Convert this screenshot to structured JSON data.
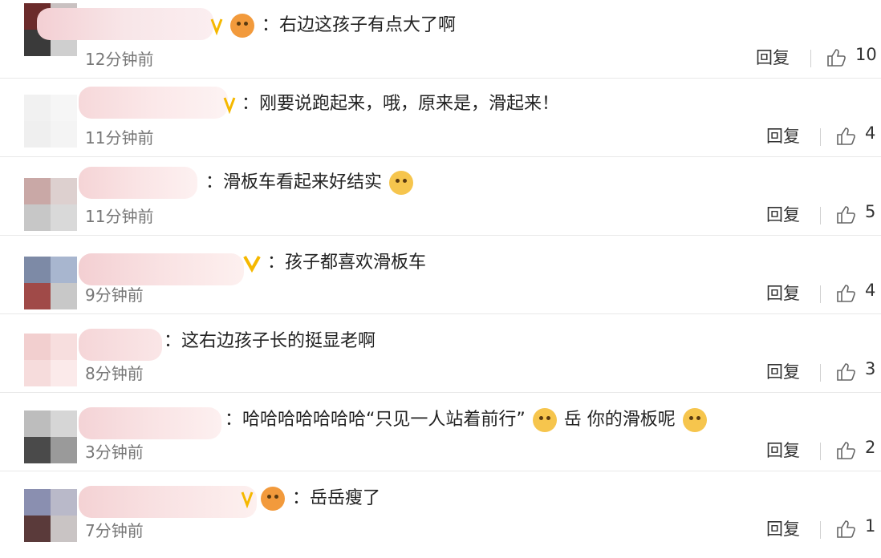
{
  "reply_label": "回复",
  "comments": [
    {
      "time": "12分钟前",
      "segments": [
        "：右边这孩子有点大了啊"
      ],
      "likes": "10"
    },
    {
      "time": "11分钟前",
      "segments": [
        "：刚要说跑起来，哦，原来是，滑起来！"
      ],
      "likes": "4"
    },
    {
      "time": "11分钟前",
      "segments": [
        "：滑板车看起来好结实"
      ],
      "likes": "5"
    },
    {
      "time": "9分钟前",
      "segments": [
        "：孩子都喜欢滑板车"
      ],
      "likes": "4"
    },
    {
      "time": "8分钟前",
      "segments": [
        "：这右边孩子长的挺显老啊"
      ],
      "likes": "3"
    },
    {
      "time": "3分钟前",
      "segments": [
        "：哈哈哈哈哈哈哈“只见一人站着前行”",
        "岳 你的滑板呢"
      ],
      "likes": "2"
    },
    {
      "time": "7分钟前",
      "segments": [
        "：岳岳瘦了"
      ],
      "likes": "1"
    }
  ],
  "colors": {
    "badge_gold": "#f5b800",
    "emoji_yellow": "#f6c54d",
    "crown_orange": "#f29a3c"
  },
  "icons": [
    "verified-v-icon",
    "crown-emoji-icon",
    "doge-emoji-icon",
    "thumbs-up-icon"
  ]
}
